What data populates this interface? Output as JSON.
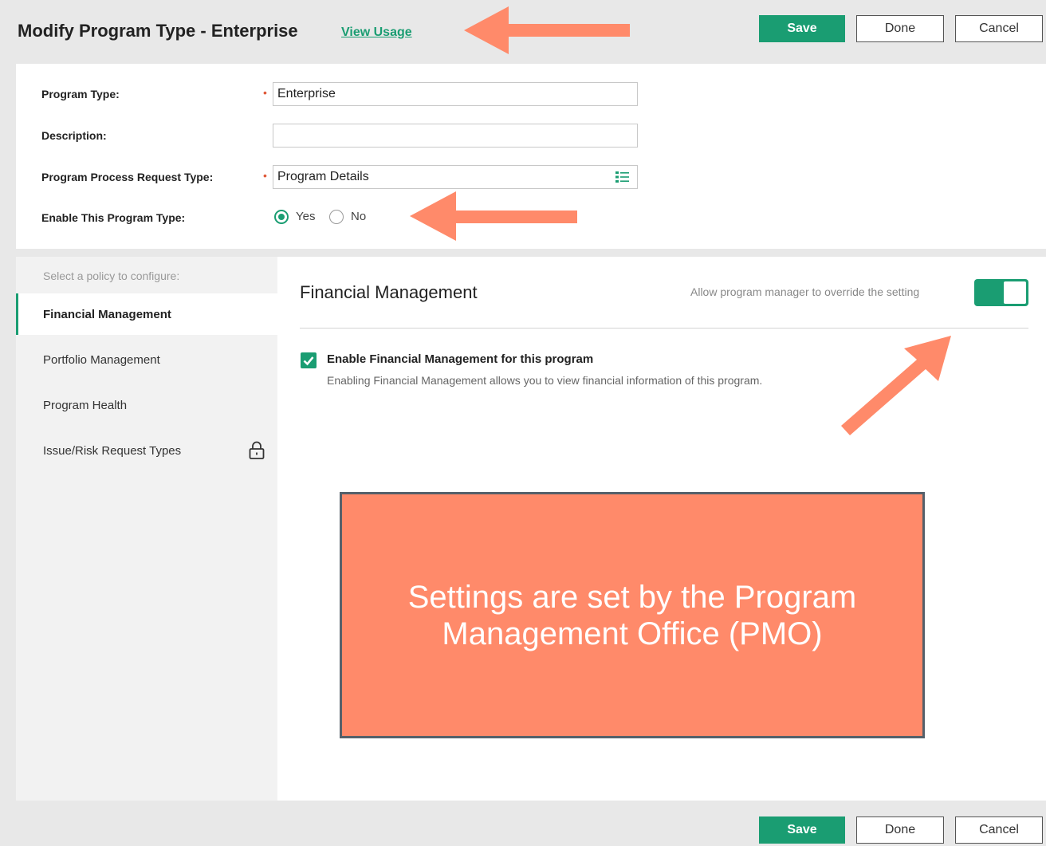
{
  "header": {
    "title": "Modify Program Type - Enterprise",
    "view_usage": "View Usage",
    "save": "Save",
    "done": "Done",
    "cancel": "Cancel"
  },
  "form": {
    "program_type": {
      "label": "Program Type:",
      "value": "Enterprise",
      "required": true
    },
    "description": {
      "label": "Description:",
      "value": ""
    },
    "process_request_type": {
      "label": "Program Process Request Type:",
      "value": "Program Details",
      "required": true
    },
    "enable": {
      "label": "Enable This Program Type:",
      "yes": "Yes",
      "no": "No",
      "selected": "Yes"
    }
  },
  "policy": {
    "hint": "Select a policy to configure:",
    "items": [
      {
        "label": "Financial Management",
        "active": true
      },
      {
        "label": "Portfolio Management",
        "active": false
      },
      {
        "label": "Program Health",
        "active": false
      },
      {
        "label": "Issue/Risk Request Types",
        "active": false,
        "locked": true
      }
    ]
  },
  "section": {
    "title": "Financial Management",
    "override_label": "Allow program manager to override the setting",
    "override_enabled": true,
    "checkbox_label": "Enable Financial Management for this program",
    "checkbox_checked": true,
    "checkbox_desc": "Enabling Financial Management allows you to view financial information of this program."
  },
  "overlay": {
    "text": "Settings are set by the Program Management Office (PMO)"
  },
  "footer": {
    "save": "Save",
    "done": "Done",
    "cancel": "Cancel"
  },
  "colors": {
    "accent": "#1a9d72",
    "annotation_arrow": "#ff8a6a",
    "overlay_bg": "#ff8a6a",
    "required": "#e05a3a"
  }
}
